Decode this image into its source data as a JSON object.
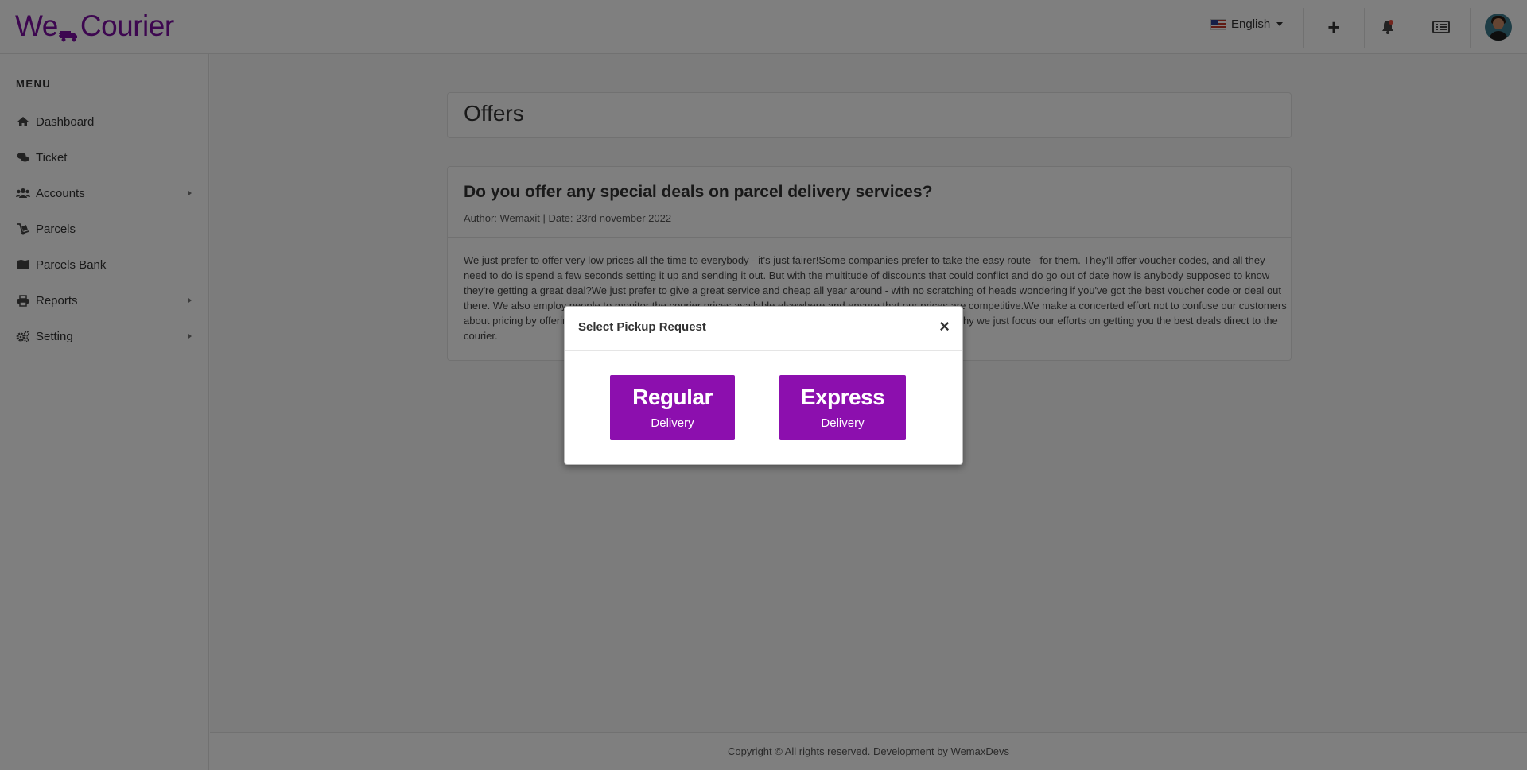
{
  "header": {
    "logo_left": "We",
    "logo_right": "Courier",
    "language": "English"
  },
  "sidebar": {
    "menu_title": "MENU",
    "items": [
      {
        "label": "Dashboard",
        "icon": "home-icon",
        "has_submenu": false
      },
      {
        "label": "Ticket",
        "icon": "comments-icon",
        "has_submenu": false
      },
      {
        "label": "Accounts",
        "icon": "users-icon",
        "has_submenu": true
      },
      {
        "label": "Parcels",
        "icon": "dolly-icon",
        "has_submenu": false
      },
      {
        "label": "Parcels Bank",
        "icon": "map-icon",
        "has_submenu": false
      },
      {
        "label": "Reports",
        "icon": "print-icon",
        "has_submenu": true
      },
      {
        "label": "Setting",
        "icon": "cogs-icon",
        "has_submenu": true
      }
    ]
  },
  "main": {
    "page_title": "Offers",
    "post": {
      "title": "Do you offer any special deals on parcel delivery services?",
      "meta": "Author: Wemaxit | Date: 23rd november 2022",
      "body": "We just prefer to offer very low prices all the time to everybody - it's just fairer!Some companies prefer to take the easy route - for them. They'll offer voucher codes, and all they need to do is spend a few seconds setting it up and sending it out. But with the multitude of discounts that could conflict and do go out of date how is anybody supposed to know they're getting a great deal?We just prefer to give a great service and cheap all year around - with no scratching of heads wondering if you've got the best voucher code or deal out there. We also employ people to monitor the courier prices available elsewhere and ensure that our prices are competitive.We make a concerted effort not to confuse our customers about pricing by offering the same great low prices to everyone using our parcel delivery services. So that's why we just focus our efforts on getting you the best deals direct to the courier."
    },
    "footer": "Copyright © All rights reserved. Development by WemaxDevs"
  },
  "modal": {
    "title": "Select Pickup Request",
    "close": "×",
    "buttons": [
      {
        "big": "Regular",
        "small": "Delivery"
      },
      {
        "big": "Express",
        "small": "Delivery"
      }
    ]
  },
  "colors": {
    "brand": "#7a0ea0",
    "button": "#8c0fae"
  }
}
